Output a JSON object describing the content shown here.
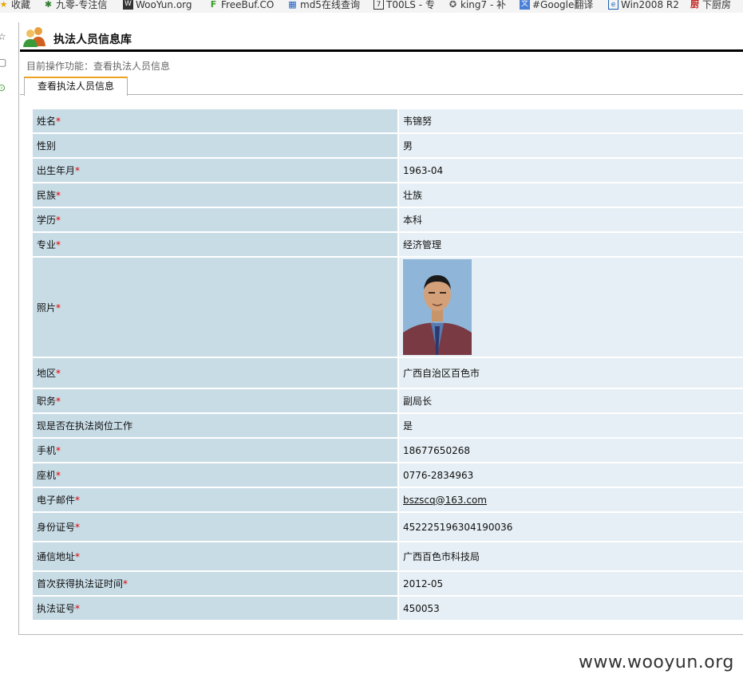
{
  "bookmarks": [
    {
      "label": "收藏",
      "icon": "star-icon"
    },
    {
      "label": "九零-专注信",
      "icon": "jiuling-icon"
    },
    {
      "label": "WooYun.org",
      "icon": "wooyun-icon"
    },
    {
      "label": "FreeBuf.CO",
      "icon": "freebuf-icon"
    },
    {
      "label": "md5在线查询",
      "icon": "grid-icon"
    },
    {
      "label": "T00LS - 专",
      "icon": "tools-icon"
    },
    {
      "label": "king7 - 补",
      "icon": "star-outline-icon"
    },
    {
      "label": "#Google翻译",
      "icon": "translate-icon"
    },
    {
      "label": "Win2008 R2",
      "icon": "ie-icon"
    },
    {
      "label": "下厨房",
      "icon": "kitchen-icon"
    }
  ],
  "page": {
    "title": "执法人员信息库",
    "breadcrumb": "目前操作功能：查看执法人员信息",
    "tab_label": "查看执法人员信息"
  },
  "required_mark": "*",
  "rows": [
    {
      "label": "姓名",
      "required": true,
      "value": "韦锦努"
    },
    {
      "label": "性别",
      "required": false,
      "value": "男"
    },
    {
      "label": "出生年月",
      "required": true,
      "value": "1963-04"
    },
    {
      "label": "民族",
      "required": true,
      "value": "壮族"
    },
    {
      "label": "学历",
      "required": true,
      "value": "本科"
    },
    {
      "label": "专业",
      "required": true,
      "value": "经济管理"
    },
    {
      "label": "照片",
      "required": true,
      "value": ""
    },
    {
      "label": "地区",
      "required": true,
      "value": "广西自治区百色市"
    },
    {
      "label": "职务",
      "required": true,
      "value": "副局长"
    },
    {
      "label": "现是否在执法岗位工作",
      "required": false,
      "value": "是"
    },
    {
      "label": "手机",
      "required": true,
      "value": "18677650268"
    },
    {
      "label": "座机",
      "required": true,
      "value": "0776-2834963"
    },
    {
      "label": "电子邮件",
      "required": true,
      "value": "bszscq@163.com"
    },
    {
      "label": "身份证号",
      "required": true,
      "value": "452225196304190036"
    },
    {
      "label": "通信地址",
      "required": true,
      "value": "广西百色市科技局"
    },
    {
      "label": "首次获得执法证时间",
      "required": true,
      "value": "2012-05"
    },
    {
      "label": "执法证号",
      "required": true,
      "value": "450053"
    }
  ],
  "watermark": "www.wooyun.org",
  "colors": {
    "label_bg": "#c8dce6",
    "value_bg": "#e6eff5",
    "required": "#e00000",
    "tab_accent": "#f0a020"
  }
}
